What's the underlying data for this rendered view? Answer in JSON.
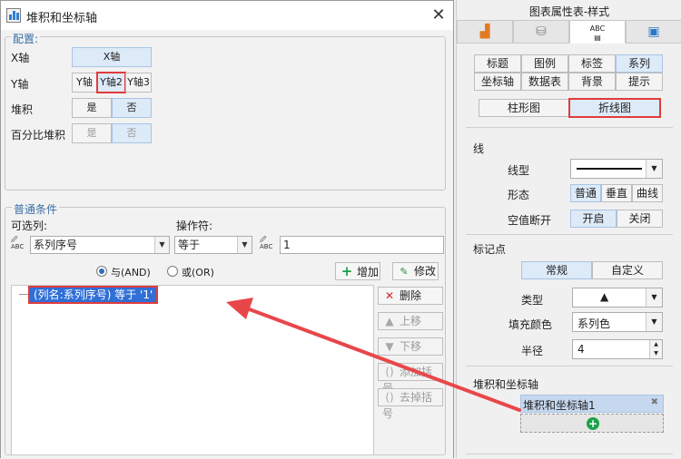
{
  "dialog": {
    "title": "堆积和坐标轴",
    "close_glyph": "✕",
    "config": {
      "legend": "配置:",
      "x_axis": {
        "label": "X轴",
        "value": "X轴"
      },
      "y_axis": {
        "label": "Y轴",
        "options": [
          "Y轴",
          "Y轴2",
          "Y轴3"
        ]
      },
      "stack": {
        "label": "堆积",
        "yes": "是",
        "no": "否"
      },
      "percent_stack": {
        "label": "百分比堆积",
        "yes": "是",
        "no": "否"
      }
    },
    "cond": {
      "legend": "普通条件",
      "column_label": "可选列:",
      "operator_label": "操作符:",
      "column_value": "系列序号",
      "operator_value": "等于",
      "value": "1",
      "radio_and": "与(AND)",
      "radio_or": "或(OR)",
      "add_button": "增加",
      "modify_button": "修改",
      "condition_item": "(列名:系列序号) 等于 '1'",
      "delete_button": "删除",
      "up_button": "上移",
      "down_button": "下移",
      "add_bracket": "添加括号",
      "remove_bracket": "去掉括号"
    }
  },
  "panel": {
    "title": "图表属性表-样式",
    "icon_tabs": [
      "chart-icon",
      "database-icon",
      "text-style-icon",
      "effect-icon"
    ],
    "tabs_row1": [
      "标题",
      "图例",
      "标签",
      "系列"
    ],
    "tabs_row2": [
      "坐标轴",
      "数据表",
      "背景",
      "提示"
    ],
    "chart_type": [
      "柱形图",
      "折线图"
    ],
    "line_section": {
      "title": "线",
      "line_type_label": "线型",
      "shape_label": "形态",
      "shape_options": [
        "普通",
        "垂直",
        "曲线"
      ],
      "gap_label": "空值断开",
      "gap_options": [
        "开启",
        "关闭"
      ]
    },
    "marker_section": {
      "title": "标记点",
      "tabs": [
        "常规",
        "自定义"
      ],
      "type_label": "类型",
      "type_value": "▲",
      "fill_label": "填充颜色",
      "fill_value": "系列色",
      "radius_label": "半径",
      "radius_value": "4"
    },
    "stack_section": {
      "title": "堆积和坐标轴",
      "item": "堆积和坐标轴1",
      "remove_glyph": "✖",
      "add_glyph": "+"
    }
  },
  "colors": {
    "highlight_red": "#e03c3c",
    "selected_blue": "#2f6fd6",
    "accent_green": "#1aa34a"
  }
}
